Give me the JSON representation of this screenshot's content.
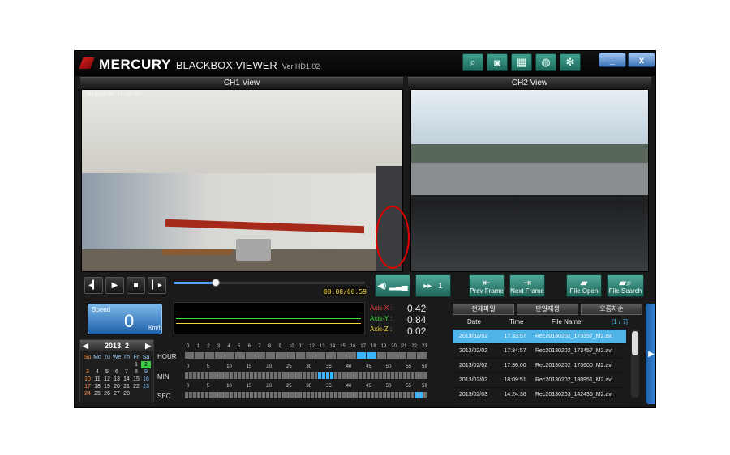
{
  "app": {
    "brand_mark": "MERCURY",
    "brand_name": "BLACKBOX VIEWER",
    "version": "Ver HD1.02",
    "toolbar_icons": [
      "zoom-icon",
      "camera-icon",
      "map-icon",
      "globe-icon",
      "gear-icon"
    ],
    "window_buttons": {
      "minimize": "_",
      "close": "x"
    }
  },
  "channels": {
    "ch1_title": "CH1 View",
    "ch2_title": "CH2 View",
    "ch1_overlay_text": "2013/02/02 17:33:57 ..."
  },
  "playback": {
    "progress": 0.22,
    "time_display": "00:08/00:59",
    "volume_icon": "speaker-icon",
    "speed_value": "1",
    "prev_frame_label": "Prev Frame",
    "next_frame_label": "Next Frame",
    "file_open_label": "File Open",
    "file_search_label": "File Search"
  },
  "speed": {
    "label": "Speed",
    "value": "0",
    "unit": "Km/h"
  },
  "axis": {
    "x": {
      "label": "Axis-X :",
      "value": "0.42",
      "color": "#ff3b3b"
    },
    "y": {
      "label": "Axis-Y :",
      "value": "0.84",
      "color": "#39e039"
    },
    "z": {
      "label": "Axis-Z :",
      "value": "0.02",
      "color": "#f3d63a"
    }
  },
  "calendar": {
    "month_label": "2013, 2",
    "weekdays": [
      "Su",
      "Mo",
      "Tu",
      "We",
      "Th",
      "Fr",
      "Sa"
    ],
    "days": [
      "",
      "",
      "",
      "",
      "",
      "1",
      "2",
      "3",
      "4",
      "5",
      "6",
      "7",
      "8",
      "9",
      "10",
      "11",
      "12",
      "13",
      "14",
      "15",
      "16",
      "17",
      "18",
      "19",
      "20",
      "21",
      "22",
      "23",
      "24",
      "25",
      "26",
      "27",
      "28"
    ]
  },
  "timeline": {
    "hour_label": "HOUR",
    "min_label": "MIN",
    "sec_label": "SEC",
    "hour_ticks": [
      "0",
      "1",
      "2",
      "3",
      "4",
      "5",
      "6",
      "7",
      "8",
      "9",
      "10",
      "11",
      "12",
      "13",
      "14",
      "15",
      "16",
      "17",
      "18",
      "19",
      "20",
      "21",
      "22",
      "23"
    ],
    "minsec_ticks": [
      "0",
      "5",
      "10",
      "15",
      "20",
      "25",
      "30",
      "35",
      "40",
      "45",
      "50",
      "55",
      "59"
    ]
  },
  "filelist": {
    "tabs": [
      "전체파일",
      "단일재생",
      "오름차순"
    ],
    "headers": {
      "date": "Date",
      "time": "Time",
      "file": "File Name",
      "pager": "[1 / 7]"
    },
    "rows": [
      {
        "date": "2013/02/02",
        "time": "17:33:57",
        "file": "Rec20130202_173357_M2.avi",
        "selected": true
      },
      {
        "date": "2013/02/02",
        "time": "17:34:57",
        "file": "Rec20130202_173457_M2.avi",
        "selected": false
      },
      {
        "date": "2013/02/02",
        "time": "17:36:00",
        "file": "Rec20130202_173600_M2.avi",
        "selected": false
      },
      {
        "date": "2013/02/02",
        "time": "18:09:51",
        "file": "Rec20130202_180951_M2.avi",
        "selected": false
      },
      {
        "date": "2013/02/03",
        "time": "14:24:36",
        "file": "Rec20130203_142436_M2.avi",
        "selected": false
      }
    ]
  },
  "colors": {
    "accent": "#4fb4e8",
    "teal": "#2f8a7a",
    "brand_red": "#d91b1b"
  }
}
